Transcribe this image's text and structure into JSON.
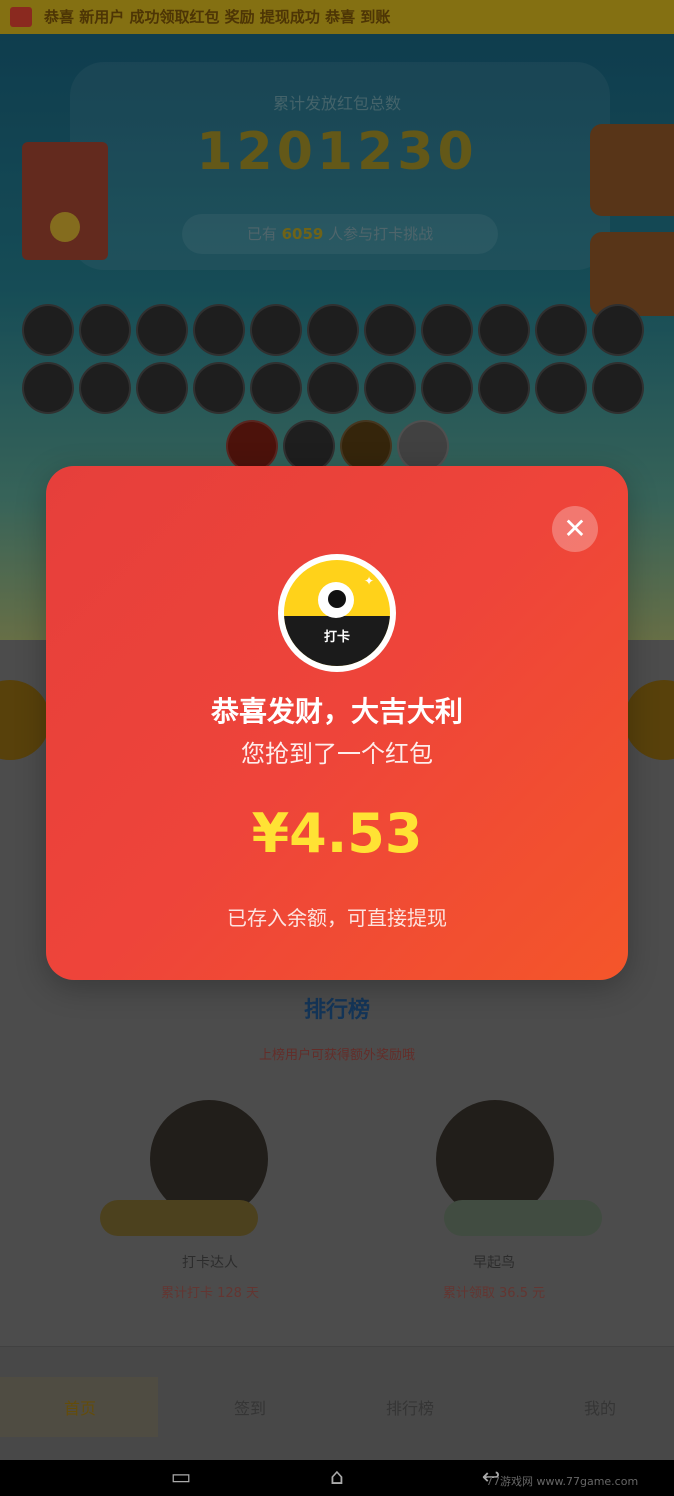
{
  "background": {
    "marquee_text": "恭喜 新用户 成功领取红包 奖励 提现成功 恭喜 到账",
    "stat_label": "累计发放红包总数",
    "stat_number": "1201230",
    "stat_pill_prefix": "已有",
    "stat_pill_highlight": "6059",
    "stat_pill_suffix": "人参与打卡挑战",
    "mid_tab_label": "排行榜",
    "mid_note": "上榜用户可获得额外奖励哦",
    "users": [
      {
        "name": "打卡达人",
        "desc": "累计打卡 128 天"
      },
      {
        "name": "早起鸟",
        "desc": "累计领取 36.5 元"
      }
    ]
  },
  "tabbar": {
    "items": [
      "首页",
      "签到",
      "排行榜",
      "我的"
    ]
  },
  "modal": {
    "logo_text": "打卡",
    "title": "恭喜发财，大吉大利",
    "subtitle": "您抢到了一个红包",
    "amount": "¥4.53",
    "note": "已存入余额，可直接提现",
    "close_glyph": "✕"
  },
  "watermark": "77游戏网 www.77game.com",
  "colors": {
    "modal_red": "#ee443a",
    "amount_yellow": "#ffe234",
    "logo_yellow": "#ffd21a"
  }
}
